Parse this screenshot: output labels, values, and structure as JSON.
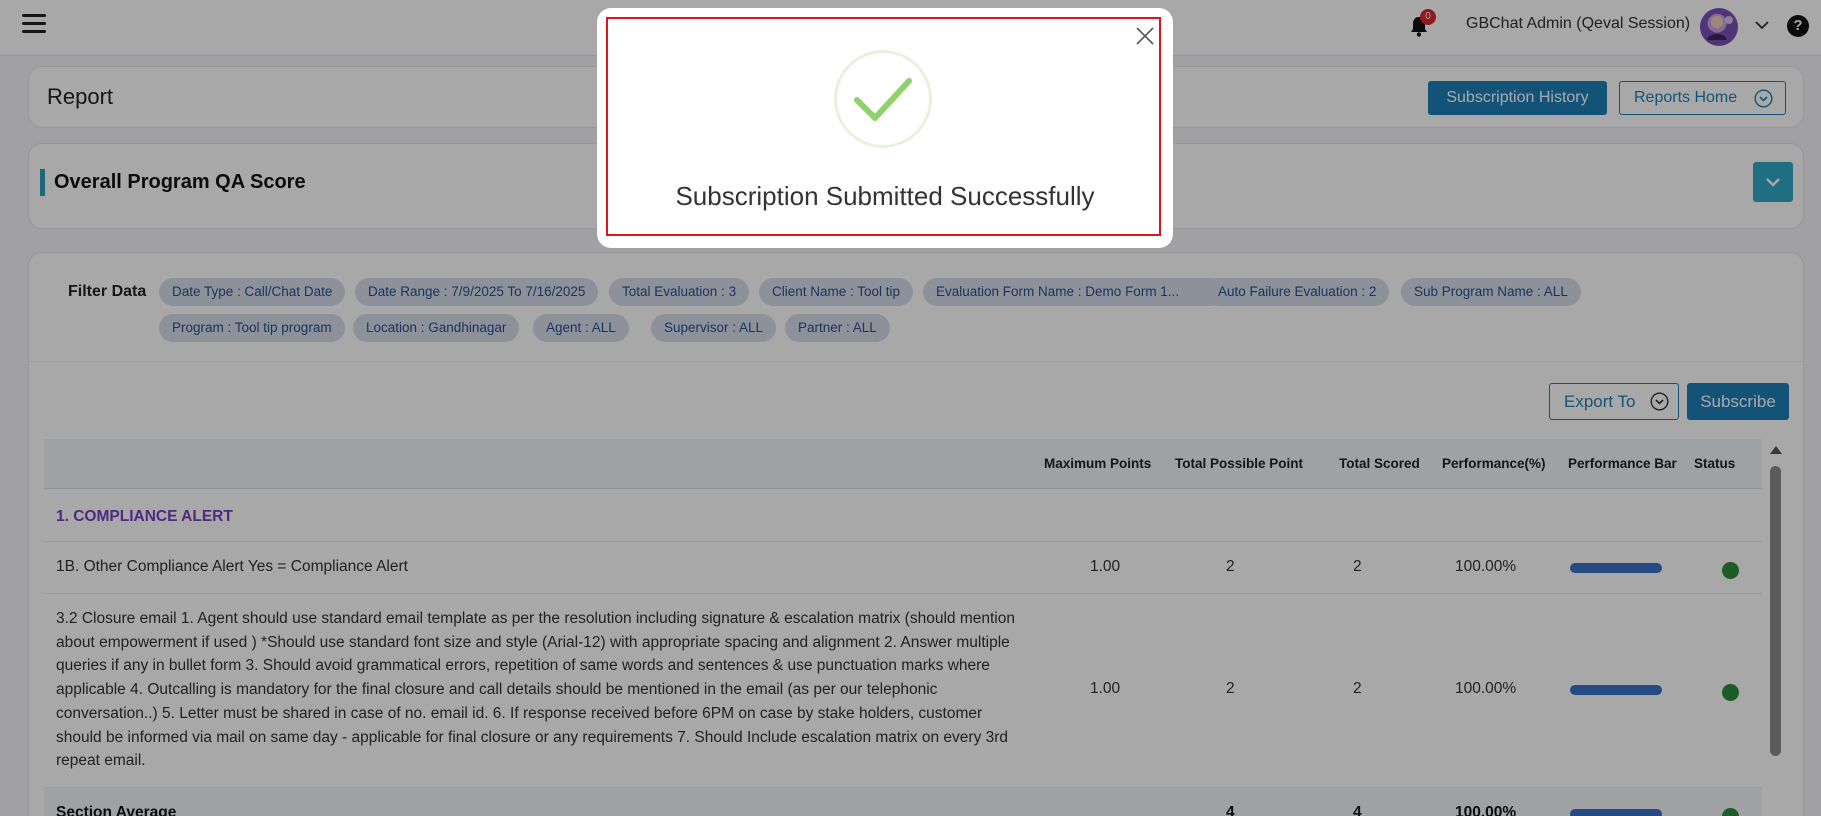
{
  "header": {
    "notification_count": "0",
    "user_name": "GBChat Admin (Qeval Session)",
    "help_label": "?"
  },
  "report": {
    "title": "Report",
    "subscription_history_label": "Subscription History",
    "reports_home_label": "Reports Home"
  },
  "qa_score": {
    "title": "Overall Program QA Score"
  },
  "filters": {
    "label": "Filter Data",
    "chips": [
      "Date Type : Call/Chat Date",
      "Date Range : 7/9/2025 To 7/16/2025",
      "Total Evaluation : 3",
      "Client Name : Tool tip",
      "Evaluation Form Name : Demo Form 1...",
      "Auto Failure Evaluation : 2",
      "Sub Program Name : ALL",
      "Program : Tool tip program",
      "Location : Gandhinagar",
      "Agent : ALL",
      "Supervisor : ALL",
      "Partner : ALL"
    ]
  },
  "actions": {
    "export_label": "Export To",
    "subscribe_label": "Subscribe"
  },
  "table": {
    "columns": [
      "Maximum Points",
      "Total Possible Point",
      "Total Scored",
      "Performance(%)",
      "Performance Bar",
      "Status"
    ],
    "section_title": "1. COMPLIANCE ALERT",
    "rows": [
      {
        "text": "1B. Other Compliance Alert Yes = Compliance Alert",
        "max_points": "1.00",
        "possible": "2",
        "scored": "2",
        "performance": "100.00%",
        "perf_fraction": 1.0
      },
      {
        "text": "3.2 Closure email 1. Agent should use standard email template as per the resolution including signature & escalation matrix (should mention about empowerment if used ) *Should use standard font size and style (Arial-12) with appropriate spacing and alignment 2. Answer multiple queries if any in bullet form 3. Should avoid grammatical errors, repetition of same words and sentences & use punctuation marks where applicable 4. Outcalling is mandatory for the final closure and call details should be mentioned in the email (as per our telephonic conversation..) 5. Letter must be shared in case of no. email id. 6. If response received before 6PM on case by stake holders, customer should be informed via mail on same day - applicable for final closure or any requirements 7. Should Include escalation matrix on every 3rd repeat email.",
        "max_points": "1.00",
        "possible": "2",
        "scored": "2",
        "performance": "100.00%",
        "perf_fraction": 1.0
      }
    ],
    "section_average": {
      "label": "Section Average",
      "possible": "4",
      "scored": "4",
      "performance": "100.00%",
      "perf_fraction": 1.0
    }
  },
  "modal": {
    "message": "Subscription Submitted Successfully"
  },
  "colors": {
    "primary": "#1f7fb6",
    "section_title": "#7a3fc2",
    "status_ok": "#2c8a3c",
    "perf_bar": "#3b73c6",
    "highlight_border": "#e0141e",
    "check_green": "#8fd16a"
  },
  "icons": [
    "hamburger-icon",
    "bell-icon",
    "chevron-down-icon",
    "help-icon",
    "close-icon",
    "check-icon"
  ]
}
